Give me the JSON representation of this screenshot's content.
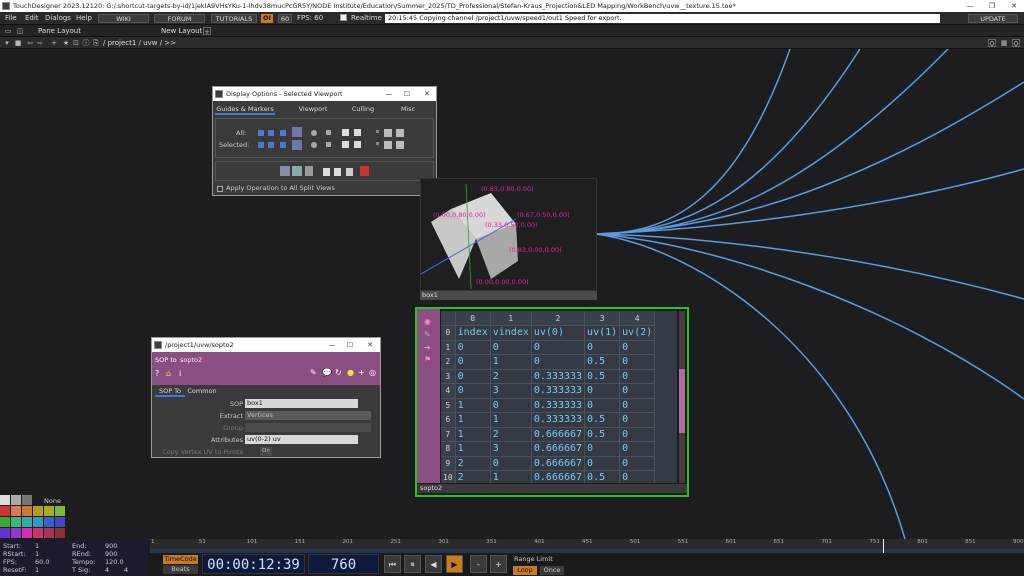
{
  "window": {
    "title": "TouchDesigner 2023.12120: G:/.shortcut-targets-by-id/1jekIA9VHsYKu-1-lhdv38mucPcGR5Y/NODE Institute/Education/Summer_2025/TD_Professional/Stefan-Kraus_Projection&LED Mapping/WorkBench/uvw__texture.15.toe*"
  },
  "menubar": {
    "items": [
      "File",
      "Edit",
      "Dialogs",
      "Help"
    ],
    "wiki": "WIKI",
    "forum": "FORUM",
    "tutorials": "TUTORIALS",
    "oi": "OI",
    "fps_label": "60",
    "fps_text": "FPS:  60",
    "realtime": "Realtime",
    "status": "20:15:45 Copying channel /project1/uvw/speed1/out1 Speed for export.",
    "update": "UPDATE"
  },
  "panebar": {
    "pane_layout": "Pane Layout",
    "new_layout": "New Layout"
  },
  "pathbar": {
    "path": "/ project1 / uvw / >>",
    "right_btns": [
      "0",
      "0"
    ]
  },
  "display_options": {
    "title": "Display Options - Selected Viewport",
    "tabs": [
      "Guides & Markers",
      "Viewport",
      "Culling",
      "Misc"
    ],
    "all_label": "All:",
    "selected_label": "Selected:",
    "apply_label": "Apply Operation to All Split Views"
  },
  "box_viewer": {
    "name": "box1",
    "labels": [
      "(0.83,0.80,0.00)",
      "(0.00,0.80,0.00)",
      "(0.67,0.50,0.00)",
      "(0.33,0.50,0.00)",
      "(0.83,0.00,0.00)",
      "(0.00,0.00,0.00)"
    ]
  },
  "table_dat": {
    "name": "sopto2",
    "col_headers": [
      "",
      "0",
      "1",
      "2",
      "3",
      "4"
    ],
    "rows": [
      [
        "0",
        "index",
        "vindex",
        "uv(0)",
        "uv(1)",
        "uv(2)"
      ],
      [
        "1",
        "0",
        "0",
        "0",
        "0",
        "0"
      ],
      [
        "2",
        "0",
        "1",
        "0",
        "0.5",
        "0"
      ],
      [
        "3",
        "0",
        "2",
        "0.333333",
        "0.5",
        "0"
      ],
      [
        "4",
        "0",
        "3",
        "0.333333",
        "0",
        "0"
      ],
      [
        "5",
        "1",
        "0",
        "0.333333",
        "0",
        "0"
      ],
      [
        "6",
        "1",
        "1",
        "0.333333",
        "0.5",
        "0"
      ],
      [
        "7",
        "1",
        "2",
        "0.666667",
        "0.5",
        "0"
      ],
      [
        "8",
        "1",
        "3",
        "0.666667",
        "0",
        "0"
      ],
      [
        "9",
        "2",
        "0",
        "0.666667",
        "0",
        "0"
      ],
      [
        "10",
        "2",
        "1",
        "0.666667",
        "0.5",
        "0"
      ]
    ]
  },
  "sopto_window": {
    "title": "/project1/uvw/sopto2",
    "op_type": "SOP to",
    "op_name": "sopto2",
    "tabs": [
      "SOP To",
      "Common"
    ],
    "params": [
      {
        "label": "SOP",
        "value": "box1"
      },
      {
        "label": "Extract",
        "value": "Vertices"
      },
      {
        "label": "Group",
        "value": ""
      },
      {
        "label": "Attributes",
        "value": "uv(0-2) uv"
      },
      {
        "label": "Copy Vertex UV to Points",
        "value": "On"
      }
    ]
  },
  "palette": {
    "none_label": "None"
  },
  "stats": {
    "start_label": "Start:",
    "start": "1",
    "end_label": "End:",
    "end": "900",
    "rstart_label": "RStart:",
    "rstart": "1",
    "rend_label": "REnd:",
    "rend": "900",
    "fps_label": "FPS:",
    "fps": "60.0",
    "tempo_label": "Tempo:",
    "tempo": "120.0",
    "resetf_label": "ResetF:",
    "resetf": "1",
    "tsig_label": "T Sig:",
    "tsig_a": "4",
    "tsig_b": "4"
  },
  "timeline": {
    "ticks": [
      "1",
      "51",
      "101",
      "151",
      "201",
      "251",
      "301",
      "351",
      "401",
      "451",
      "501",
      "551",
      "601",
      "651",
      "701",
      "751",
      "801",
      "851",
      "900"
    ],
    "timecode_btn": "TimeCode",
    "beats_btn": "Beats",
    "timecode": "00:00:12:39",
    "frame": "760",
    "range_limit": "Range Limit",
    "loop": "Loop",
    "once": "Once",
    "ctrl": [
      "⏮",
      "⏸",
      "◀",
      "▶",
      "-",
      "+"
    ]
  }
}
